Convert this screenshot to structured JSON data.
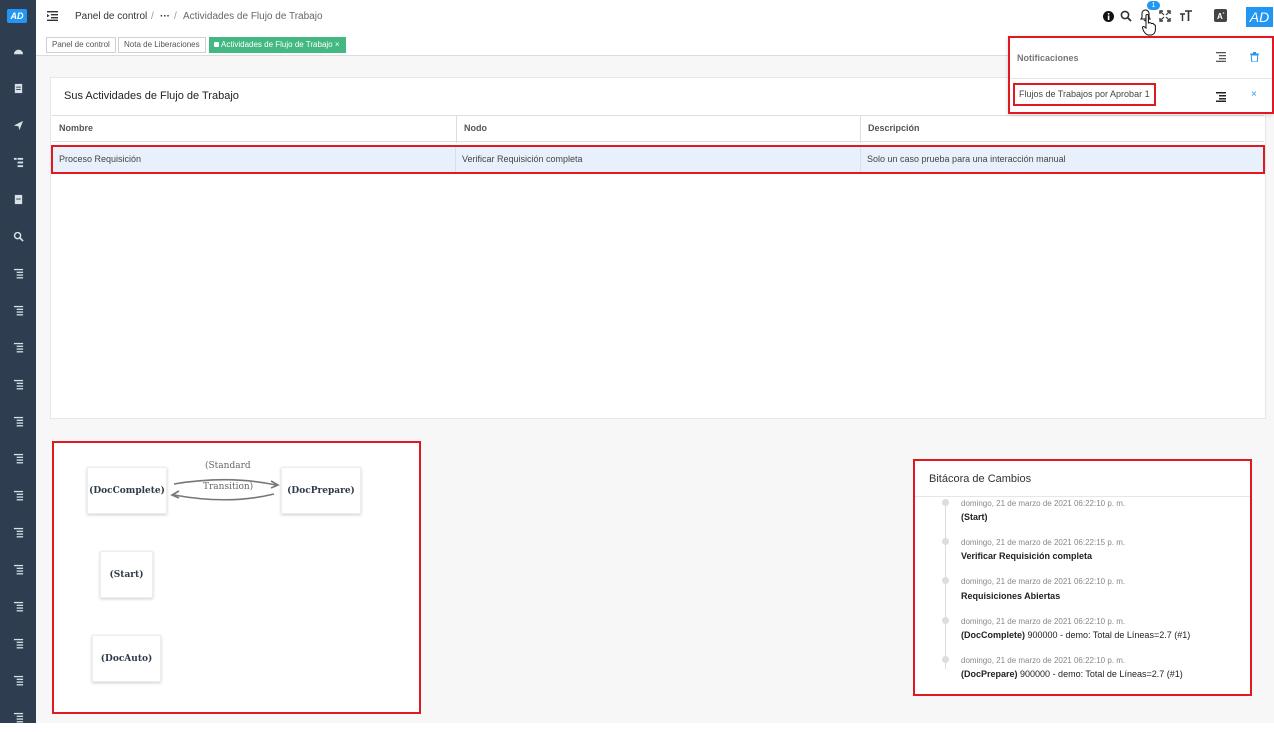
{
  "app": {
    "logo_text": "AD",
    "avatar_text": "AD"
  },
  "breadcrumb": {
    "home": "Panel de control",
    "sep1": "/",
    "ellipsis": "···",
    "sep2": "/",
    "current": "Actividades de Flujo de Trabajo"
  },
  "header_icons": [
    "info-icon",
    "search-icon",
    "bell-icon",
    "fullscreen-icon",
    "text-size-icon",
    "translate-icon"
  ],
  "notification_count": "1",
  "tabs": [
    {
      "label": "Panel de control"
    },
    {
      "label": "Nota de Liberaciones"
    },
    {
      "label": "Actividades de Flujo de Trabajo",
      "close": "×"
    }
  ],
  "activities": {
    "title": "Sus Actividades de Flujo de Trabajo",
    "columns": [
      "Nombre",
      "Nodo",
      "Descripción"
    ],
    "rows": [
      {
        "name": "Proceso Requisición",
        "node": "Verificar Requisición completa",
        "description": "Solo un caso prueba para una interacción manual"
      }
    ]
  },
  "notifications": {
    "title": "Notificaciones",
    "items": [
      {
        "label": "Flujos de Trabajos por Aprobar 1",
        "close": "×"
      }
    ]
  },
  "workflow": {
    "nodes": [
      "(DocComplete)",
      "(DocPrepare)",
      "(Start)",
      "(DocAuto)"
    ],
    "edge_label_1": "(Standard",
    "edge_label_2": "Transition)"
  },
  "log": {
    "title": "Bitácora de Cambios",
    "entries": [
      {
        "date": "domingo, 21 de marzo de 2021 06:22:10 p. m.",
        "bold": "(Start)",
        "rest": ""
      },
      {
        "date": "domingo, 21 de marzo de 2021 06:22:15 p. m.",
        "bold": "Verificar Requisición completa",
        "rest": ""
      },
      {
        "date": "domingo, 21 de marzo de 2021 06:22:10 p. m.",
        "bold": "Requisiciones Abiertas",
        "rest": ""
      },
      {
        "date": "domingo, 21 de marzo de 2021 06:22:10 p. m.",
        "bold": "(DocComplete)",
        "rest": " 900000 - demo: Total de Líneas=2.7 (#1)"
      },
      {
        "date": "domingo, 21 de marzo de 2021 06:22:10 p. m.",
        "bold": "(DocPrepare)",
        "rest": " 900000 - demo: Total de Líneas=2.7 (#1)"
      }
    ]
  },
  "colors": {
    "sidebar": "#2e3e50",
    "accent": "#2196f3",
    "active_tab": "#44b883",
    "highlight_border": "#e0181f"
  }
}
